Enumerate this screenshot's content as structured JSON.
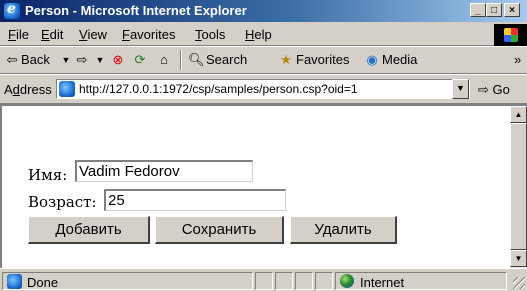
{
  "window": {
    "title": "Person - Microsoft Internet Explorer",
    "minimize_glyph": "_",
    "maximize_glyph": "□",
    "close_glyph": "×"
  },
  "menu": [
    "File",
    "Edit",
    "View",
    "Favorites",
    "Tools",
    "Help"
  ],
  "toolbar": {
    "back": "Back",
    "search": "Search",
    "favorites": "Favorites",
    "media": "Media",
    "more": "»"
  },
  "address": {
    "label_first": "A",
    "label_underline": "d",
    "label_rest": "dress",
    "url": "http://127.0.0.1:1972/csp/samples/person.csp?oid=1",
    "go": "Go"
  },
  "form": {
    "name_label": "Имя:",
    "name_value": "Vadim Fedorov",
    "age_label": "Возраст:",
    "age_value": "25",
    "buttons": {
      "add": "Добавить",
      "save": "Сохранить",
      "delete": "Удалить"
    }
  },
  "status": {
    "text": "Done",
    "zone": "Internet"
  }
}
